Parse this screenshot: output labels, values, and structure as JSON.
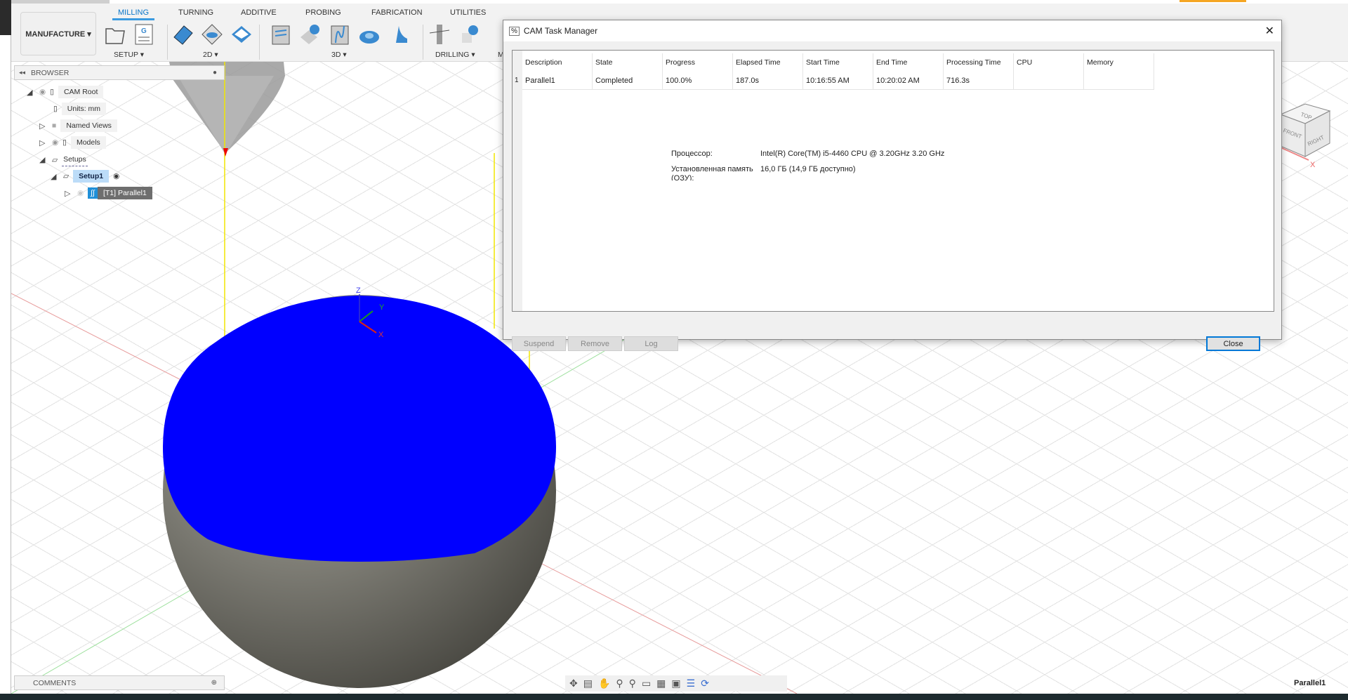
{
  "toolbar": {
    "workspace": "MANUFACTURE ▾",
    "tabs": [
      "MILLING",
      "TURNING",
      "ADDITIVE",
      "PROBING",
      "FABRICATION",
      "UTILITIES"
    ],
    "groups": [
      "SETUP ▾",
      "2D ▾",
      "3D ▾",
      "DRILLING ▾",
      "M"
    ]
  },
  "browser": {
    "title": "BROWSER",
    "items": [
      {
        "label": "CAM Root"
      },
      {
        "label": "Units: mm"
      },
      {
        "label": "Named Views"
      },
      {
        "label": "Models"
      },
      {
        "label": "Setups"
      },
      {
        "label": "Setup1"
      },
      {
        "label": "[T1] Parallel1"
      }
    ]
  },
  "comments": {
    "title": "COMMENTS"
  },
  "dialog": {
    "title": "CAM Task Manager",
    "columns": [
      "Description",
      "State",
      "Progress",
      "Elapsed Time",
      "Start Time",
      "End Time",
      "Processing Time",
      "CPU",
      "Memory"
    ],
    "rows": [
      {
        "index": "1",
        "cells": [
          "Parallel1",
          "Completed",
          "100.0%",
          "187.0s",
          "10:16:55 AM",
          "10:20:02 AM",
          "716.3s",
          "",
          ""
        ]
      }
    ],
    "info": {
      "cpu_label": "Процессор:",
      "cpu_value": "Intel(R) Core(TM) i5-4460  CPU @ 3.20GHz   3.20 GHz",
      "mem_label": "Установленная память (ОЗУ):",
      "mem_value": "16,0 ГБ (14,9 ГБ доступно)"
    },
    "buttons": {
      "suspend": "Suspend",
      "remove": "Remove",
      "log": "Log",
      "close": "Close"
    }
  },
  "viewcube": {
    "top": "TOP",
    "front": "FRONT",
    "right": "RIGHT",
    "axis": "X"
  },
  "triad": {
    "x": "X",
    "y": "Y",
    "z": "Z"
  },
  "status": {
    "selection": "Parallel1"
  },
  "colors": {
    "accent": "#0b76c9",
    "toolpath": "#0000ff",
    "model": "#7a7a72"
  }
}
